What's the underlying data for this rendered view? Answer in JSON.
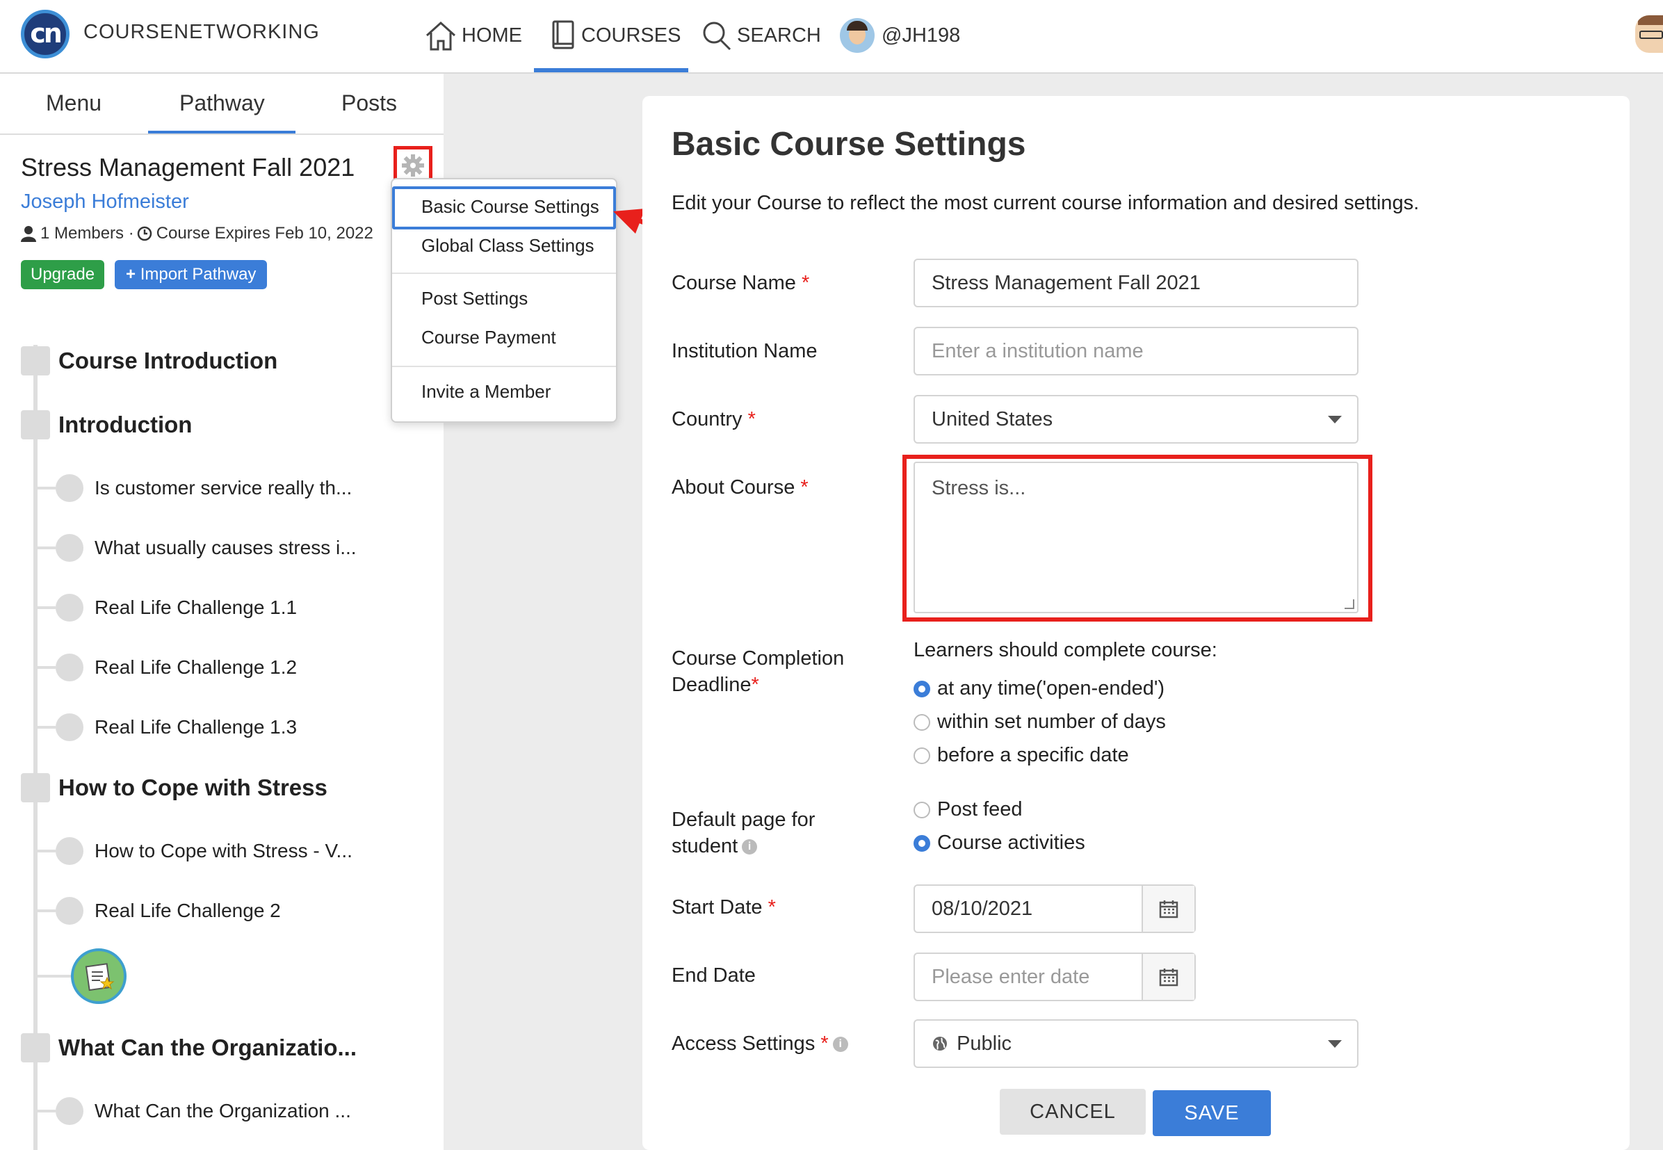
{
  "nav": {
    "brand": "COURSENETWORKING",
    "logo_text": "cn",
    "home": "HOME",
    "courses": "COURSES",
    "search": "SEARCH",
    "user": "@JH198"
  },
  "sidebar": {
    "tabs": [
      "Menu",
      "Pathway",
      "Posts"
    ],
    "active_tab": "Pathway",
    "course_title": "Stress Management Fall 2021",
    "instructor": "Joseph Hofmeister",
    "meta": "1 Members · ",
    "expires": "Course Expires Feb 10, 2022",
    "upgrade": "Upgrade",
    "import_pathway": "Import Pathway",
    "sections": [
      "Course Introduction",
      "Introduction",
      "How to Cope with Stress",
      "What Can the Organizatio..."
    ],
    "items": [
      "Is customer service really th...",
      "What usually causes stress i...",
      "Real Life Challenge 1.1",
      "Real Life Challenge 1.2",
      "Real Life Challenge 1.3",
      "How to Cope with Stress - V...",
      "Real Life Challenge 2",
      "What Can the Organization ..."
    ]
  },
  "dropdown": {
    "items": [
      "Basic Course Settings",
      "Global Class Settings",
      "Post Settings",
      "Course Payment",
      "Invite a Member"
    ]
  },
  "form": {
    "title": "Basic Course Settings",
    "description": "Edit your Course to reflect the most current course information and desired settings.",
    "course_name_label": "Course Name",
    "course_name_value": "Stress Management Fall 2021",
    "institution_label": "Institution Name",
    "institution_placeholder": "Enter a institution name",
    "country_label": "Country",
    "country_value": "United States",
    "about_label": "About Course",
    "about_value": "Stress is...",
    "completion_label_1": "Course Completion",
    "completion_label_2": "Deadline",
    "completion_prompt": "Learners should complete course:",
    "completion_options": [
      "at any time('open-ended')",
      "within set number of days",
      "before a specific date"
    ],
    "completion_selected": 0,
    "default_page_label_1": "Default page for",
    "default_page_label_2": "student",
    "default_page_options": [
      "Post feed",
      "Course activities"
    ],
    "default_page_selected": 1,
    "start_date_label": "Start Date",
    "start_date_value": "08/10/2021",
    "end_date_label": "End Date",
    "end_date_placeholder": "Please enter date",
    "access_label": "Access Settings",
    "access_value": "Public",
    "cancel": "CANCEL",
    "save": "SAVE",
    "required_mark": "*",
    "info_mark": "i"
  },
  "colors": {
    "accent": "#3b7dd8",
    "annotation_red": "#e8201c",
    "upgrade_green": "#2e9e48"
  }
}
